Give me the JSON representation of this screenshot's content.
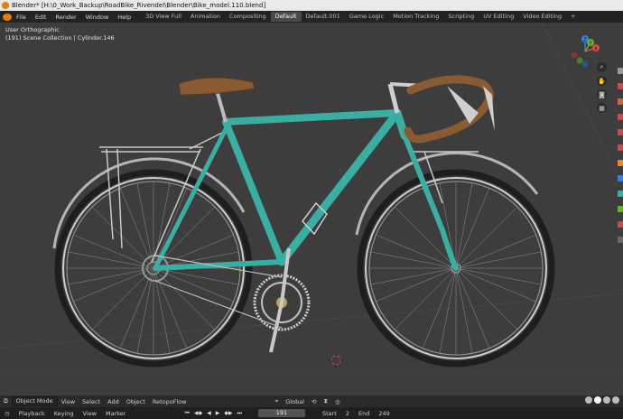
{
  "titlebar": {
    "text": "Blender* [H:\\0_Work_Backup\\RoadBike_Rivendel\\Blender\\Bike_model.110.blend]"
  },
  "menu": [
    "File",
    "Edit",
    "Render",
    "Window",
    "Help"
  ],
  "workspaces": [
    "3D View Full",
    "Animation",
    "Compositing",
    "Default",
    "Default.001",
    "Game Logic",
    "Motion Tracking",
    "Scripting",
    "UV Editing",
    "Video Editing",
    "+"
  ],
  "active_workspace": "Default",
  "viewport": {
    "view_name": "User Orthographic",
    "context": "(191) Scene Collection | Cylinder.146"
  },
  "gizmo": {
    "x_label": "X",
    "y_label": "Y",
    "z_label": "Z"
  },
  "header": {
    "mode": "Object Mode",
    "items": [
      "View",
      "Select",
      "Add",
      "Object",
      "RetopoFlow"
    ],
    "transform_orientation": "Global"
  },
  "timeline": {
    "items": [
      "Playback",
      "Keying",
      "View",
      "Marker"
    ],
    "current_frame": "191",
    "start_label": "Start",
    "start_value": "2",
    "end_label": "End",
    "end_value": "249"
  },
  "colors": {
    "frame_teal": "#3aaea3",
    "leather": "#8a5a32",
    "viewport_bg": "#3d3d3d",
    "accent_orange": "#e87d0d"
  },
  "icons": [
    "blender-logo-icon",
    "zoom-icon",
    "hand-icon",
    "camera-icon",
    "grid-icon",
    "cursor-icon"
  ]
}
